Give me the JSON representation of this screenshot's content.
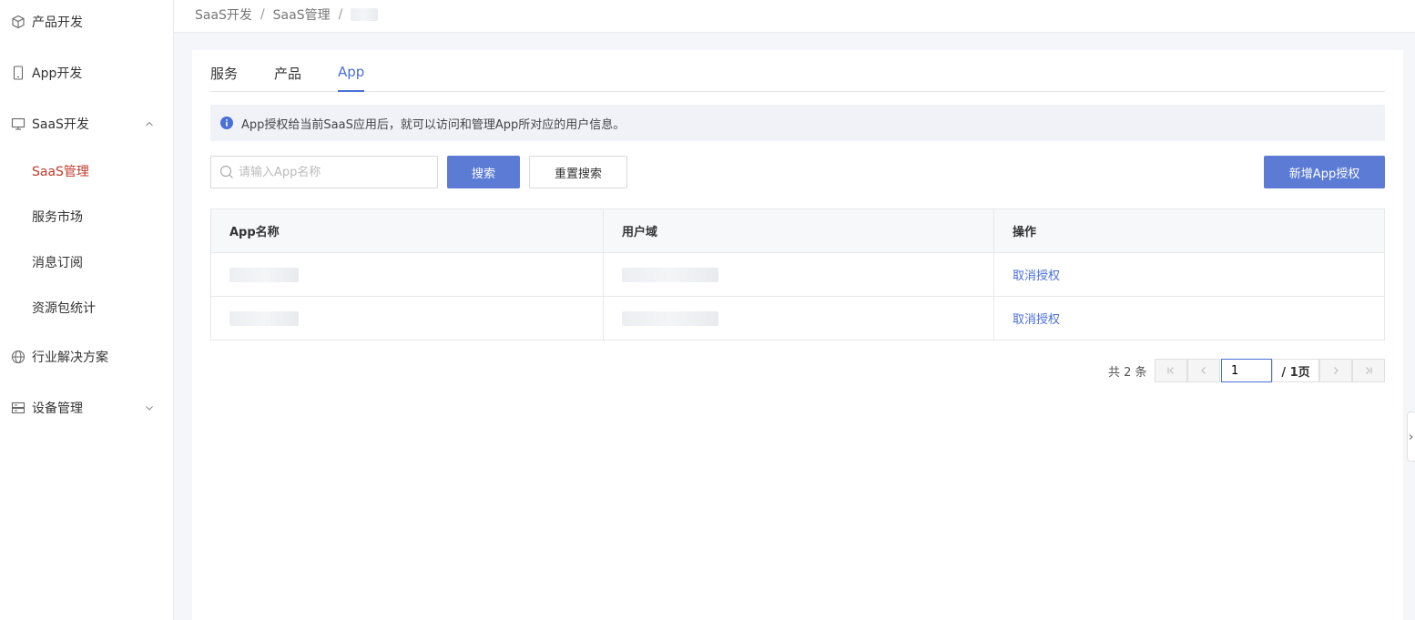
{
  "sidebar": {
    "items": [
      {
        "label": "产品开发",
        "icon": "cube-icon"
      },
      {
        "label": "App开发",
        "icon": "phone-icon"
      },
      {
        "label": "SaaS开发",
        "icon": "monitor-icon",
        "expanded": true
      },
      {
        "label": "行业解决方案",
        "icon": "globe-icon"
      },
      {
        "label": "设备管理",
        "icon": "server-icon",
        "expanded": false
      }
    ],
    "sub_items": [
      {
        "label": "SaaS管理",
        "active": true
      },
      {
        "label": "服务市场"
      },
      {
        "label": "消息订阅"
      },
      {
        "label": "资源包统计"
      }
    ]
  },
  "breadcrumb": {
    "items": [
      "SaaS开发",
      "SaaS管理"
    ],
    "separator": "/"
  },
  "tabs": [
    {
      "label": "服务"
    },
    {
      "label": "产品"
    },
    {
      "label": "App",
      "active": true
    }
  ],
  "notice": {
    "text": "App授权给当前SaaS应用后，就可以访问和管理App所对应的用户信息。"
  },
  "search": {
    "placeholder": "请输入App名称",
    "value": "",
    "search_label": "搜索",
    "reset_label": "重置搜索",
    "add_label": "新增App授权"
  },
  "table": {
    "headers": [
      "App名称",
      "用户域",
      "操作"
    ],
    "rows": [
      {
        "action": "取消授权"
      },
      {
        "action": "取消授权"
      }
    ]
  },
  "pagination": {
    "total_text": "共 2 条",
    "current_page": "1",
    "of_text": "/ 1页"
  },
  "colors": {
    "primary": "#5b7bd5",
    "link": "#4a6fd6",
    "active_sidebar": "#c0392b"
  }
}
